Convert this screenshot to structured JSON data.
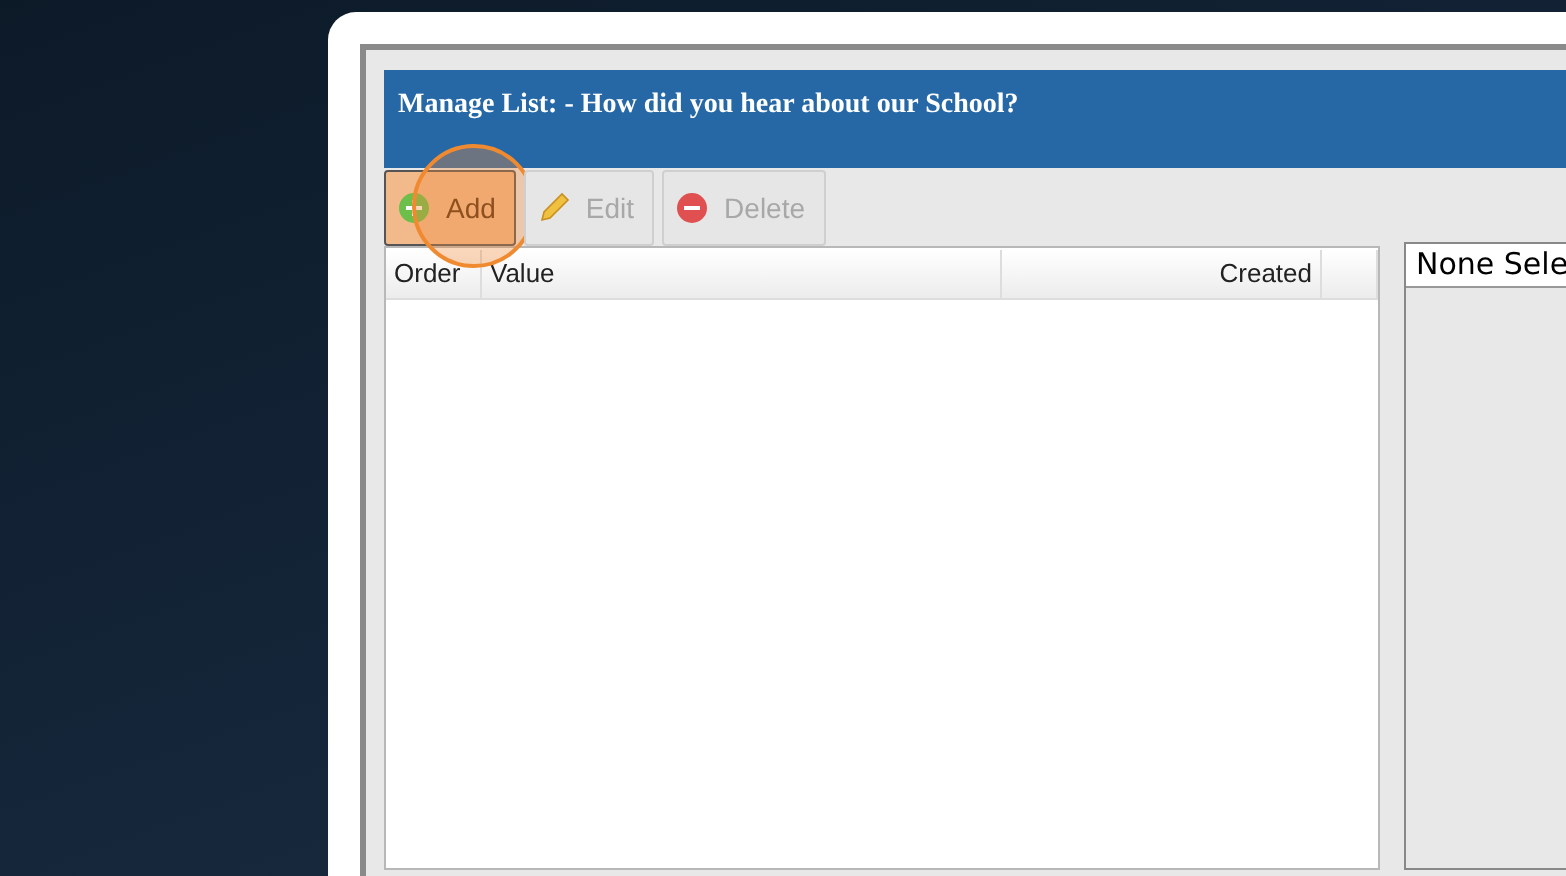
{
  "dialog": {
    "title": "Manage List: - How did you hear about our School?"
  },
  "toolbar": [
    {
      "label": "Add",
      "kind": "add",
      "disabled": false,
      "highlighted": true
    },
    {
      "label": "Edit",
      "kind": "edit",
      "disabled": true,
      "highlighted": false
    },
    {
      "label": "Delete",
      "kind": "delete",
      "disabled": true,
      "highlighted": false
    }
  ],
  "table": {
    "columns": [
      {
        "label": "Order"
      },
      {
        "label": "Value"
      },
      {
        "label": "Created"
      }
    ]
  },
  "detail": {
    "value": "None Sele"
  }
}
